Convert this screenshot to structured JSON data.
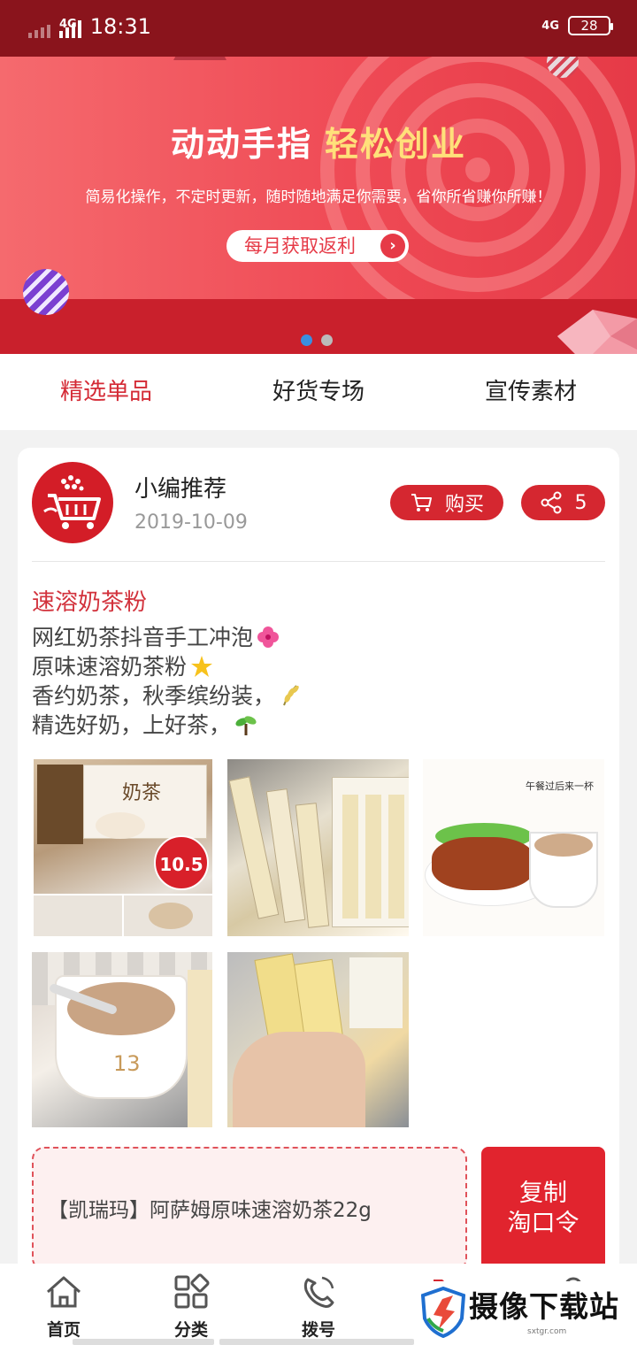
{
  "status_bar": {
    "network": "4G",
    "time": "18:31",
    "network_right": "4G",
    "battery": "28"
  },
  "banner": {
    "title": "动动手指",
    "title_highlight": "轻松创业",
    "subtitle": "简易化操作，不定时更新，随时随地满足你需要，省你所省赚你所赚！",
    "button_label": "每月获取返利",
    "active_slide": 1,
    "slide_count": 2
  },
  "tabs": [
    {
      "label": "精选单品",
      "active": true
    },
    {
      "label": "好货专场",
      "active": false
    },
    {
      "label": "宣传素材",
      "active": false
    }
  ],
  "post": {
    "author": "小编推荐",
    "date": "2019-10-09",
    "buy_label": "购买",
    "share_count": "5",
    "product_title": "速溶奶茶粉",
    "description_lines": [
      "网红奶茶抖音手工冲泡",
      "原味速溶奶茶粉",
      "香约奶茶，秋季缤纷装，",
      "精选好奶，上好茶，"
    ],
    "photo_texts": {
      "photo1_price": "10.5",
      "photo1_brand": "奶茶",
      "photo3_caption": "午餐过后来一杯",
      "photo4_cup": "13"
    },
    "command_text": "【凯瑞玛】阿萨姆原味速溶奶茶22g",
    "copy_label_line1": "复制",
    "copy_label_line2": "淘口令"
  },
  "bottom_nav": [
    {
      "label": "首页",
      "icon": "home-icon"
    },
    {
      "label": "分类",
      "icon": "category-icon"
    },
    {
      "label": "拨号",
      "icon": "phone-icon"
    }
  ],
  "watermark": {
    "text": "摄像下载站",
    "url": "sxtgr.com"
  },
  "colors": {
    "brand_red": "#d52730",
    "banner_dark": "#8a141c",
    "highlight_yellow": "#ffe07a"
  }
}
